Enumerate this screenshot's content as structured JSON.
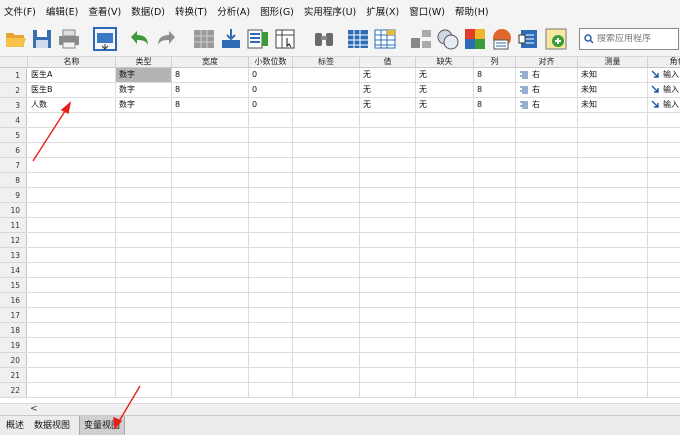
{
  "menu": [
    "文件(F)",
    "编辑(E)",
    "查看(V)",
    "数据(D)",
    "转换(T)",
    "分析(A)",
    "图形(G)",
    "实用程序(U)",
    "扩展(X)",
    "窗口(W)",
    "帮助(H)"
  ],
  "toolbar": {
    "icons": [
      "open-folder",
      "save",
      "print",
      "recall-dialog",
      "undo",
      "redo",
      "goto-case",
      "goto-variable",
      "variables",
      "find",
      "insert-cases",
      "insert-variable",
      "split-file",
      "weight-cases",
      "select-cases",
      "value-labels",
      "use-variable-sets",
      "show-all-variables",
      "spell-check"
    ],
    "search_placeholder": "搜索应用程序"
  },
  "grid": {
    "columns": [
      "名称",
      "类型",
      "宽度",
      "小数位数",
      "标签",
      "值",
      "缺失",
      "列",
      "对齐",
      "测量",
      "角色"
    ],
    "rows": [
      {
        "num": "1",
        "cells": [
          "医生A",
          "数字",
          "8",
          "0",
          "",
          "无",
          "无",
          "8",
          "右",
          "未知",
          "输入"
        ]
      },
      {
        "num": "2",
        "cells": [
          "医生B",
          "数字",
          "8",
          "0",
          "",
          "无",
          "无",
          "8",
          "右",
          "未知",
          "输入"
        ]
      },
      {
        "num": "3",
        "cells": [
          "人数",
          "数字",
          "8",
          "0",
          "",
          "无",
          "无",
          "8",
          "右",
          "未知",
          "输入"
        ]
      }
    ],
    "empty_row_numbers": [
      "4",
      "5",
      "6",
      "7",
      "8",
      "9",
      "10",
      "11",
      "12",
      "13",
      "14",
      "15",
      "16",
      "17",
      "18",
      "19",
      "20",
      "21",
      "22"
    ],
    "scroll_left_glyph": "<"
  },
  "tabs": {
    "overview": "概述",
    "data_view": "数据视图",
    "variable_view": "变量视图",
    "active": "variable_view"
  },
  "colors": {
    "annotation_arrow": "#e8201a",
    "selected_cell": "#b4b4b4",
    "header_bg": "#f0f0f0"
  }
}
